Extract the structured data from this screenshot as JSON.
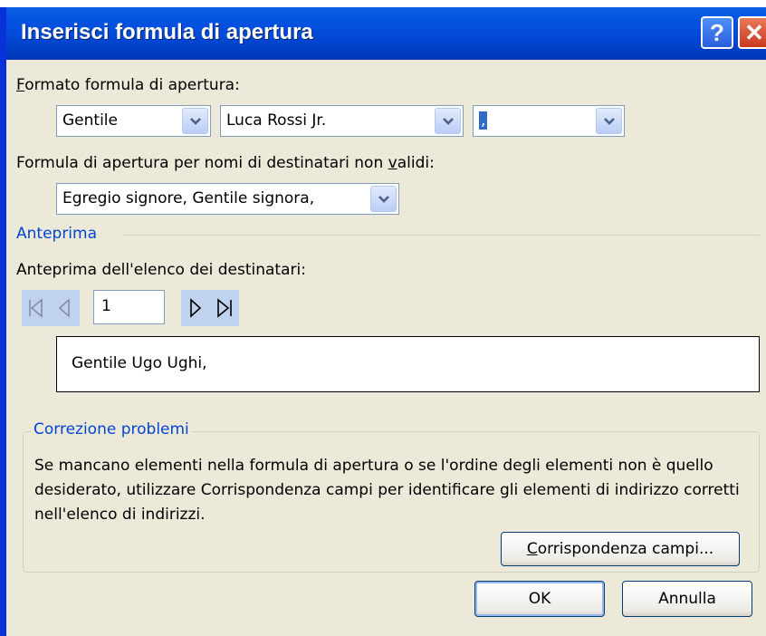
{
  "window": {
    "title": "Inserisci formula di apertura",
    "help_glyph": "?",
    "close_glyph": "✕"
  },
  "format": {
    "label_prefix": "F",
    "label_rest": "ormato formula di apertura:",
    "salutation": "Gentile",
    "name_format": "Luca Rossi Jr.",
    "punctuation": ","
  },
  "invalid": {
    "label_before": "Formula di apertura per nomi di destinatari non ",
    "label_key": "v",
    "label_after": "alidi:",
    "value": "Egregio signore, Gentile signora,"
  },
  "preview": {
    "group_title": "Anteprima",
    "list_label": "Anteprima dell'elenco dei destinatari:",
    "record_number": "1",
    "text": "Gentile Ugo Ughi,"
  },
  "problems": {
    "group_title": "Correzione problemi",
    "description": "Se mancano elementi nella formula di apertura o se l'ordine degli elementi non è quello desiderato, utilizzare Corrispondenza campi per identificare gli elementi di indirizzo corretti nell'elenco di indirizzi.",
    "match_button_key": "C",
    "match_button_rest": "orrispondenza campi..."
  },
  "buttons": {
    "ok": "OK",
    "cancel": "Annulla"
  },
  "colors": {
    "titlebar": "#0147d4",
    "dialog_bg": "#ece9d8",
    "group_title": "#0046d5"
  }
}
